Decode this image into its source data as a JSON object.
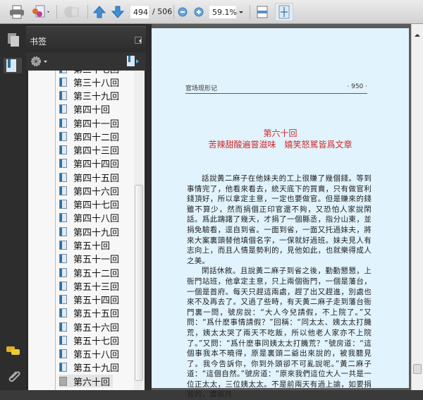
{
  "toolbar": {
    "page_current": "494",
    "page_total": "/ 506",
    "zoom": "59.1%"
  },
  "icons": [
    "print-icon",
    "collaborate-icon",
    "share-icon",
    "page-up-icon",
    "page-down-icon",
    "zoom-out-icon",
    "zoom-in-icon",
    "fit-width-icon",
    "fit-page-icon",
    "pages-icon",
    "bookmarks-icon",
    "gear-icon",
    "new-bookmark-icon",
    "comments-icon",
    "attachments-icon"
  ],
  "panel": {
    "title": "书签"
  },
  "bookmarks": [
    "第三十七回",
    "第三十八回",
    "第三十九回",
    "第四十回",
    "第四十一回",
    "第四十二回",
    "第四十三回",
    "第四十四回",
    "第四十五回",
    "第四十六回",
    "第四十七回",
    "第四十八回",
    "第四十九回",
    "第五十回",
    "第五十一回",
    "第五十二回",
    "第五十三回",
    "第五十四回",
    "第五十五回",
    "第五十六回",
    "第五十七回",
    "第五十八回",
    "第五十九回",
    "第六十回"
  ],
  "selected_bookmark": "第六十回",
  "page": {
    "running_title": "官场现形记",
    "page_number": "· 950 ·",
    "chapter": "第六十回",
    "chapter_title": "苦辣甜酸遍嘗滋味　嬉笑怒駡皆爲文章",
    "paragraphs": [
      "話說黃二麻子在他妹夫的工上很賺了幾個錢。等到事情完了，他看來看去，統天底下的買賣，只有做官利錢頂好，所以拿定主意，一定也要做官。但是賺來的錢雖不算少，然而捐個正印官還不夠，又恐怕人家說閑話。爲此躊躇了幾天，才捐了一個縣丞，指分山東，並捐免驗看，逕自到省。一面到省，一面又托過妹夫，將來大案裏頭替他填個名字，一保就好過班。妹夫見人有志向上，而且人情是勢利的，見他如此，也就樂得成人之美。",
      "閑話休敘。且說黃二麻子到省之後，勤勤懇懇，上衙門站班，他拿定主意，只上兩個衙門，一個是藩台，一個是首府。每天只趕這兩處，趕了出又趕進，別處也來不及再去了。又過了些時，有天黃二麻子走到藩台衙門裏一問，號房說：“大人今兒請假，不上院了。”又問：“爲什麽事情請假？”回稱：“同太太、姨太太打饑荒，姨太太哭了兩天不吃飯，所以他老人家亦不上院了。”又問：“爲什麽事同姨太太打饑荒？”號房道：“這個事我本不曉得，原是裏頭二爺出來說的，被我聽見了。我今告訴你，你到外頭卻不可亂說呢。”黃二麻子道：“這個自然。”號房道：“原來我們這位大人一共是一位正太太，三位姨太太。不是前兩天有過上諭，如要捐官的，盡兩月"
    ]
  },
  "colors": {
    "page_bg": "#e1f3fc",
    "chapter_red": "#d0282a",
    "panel_dark": "#2a2a2a"
  }
}
